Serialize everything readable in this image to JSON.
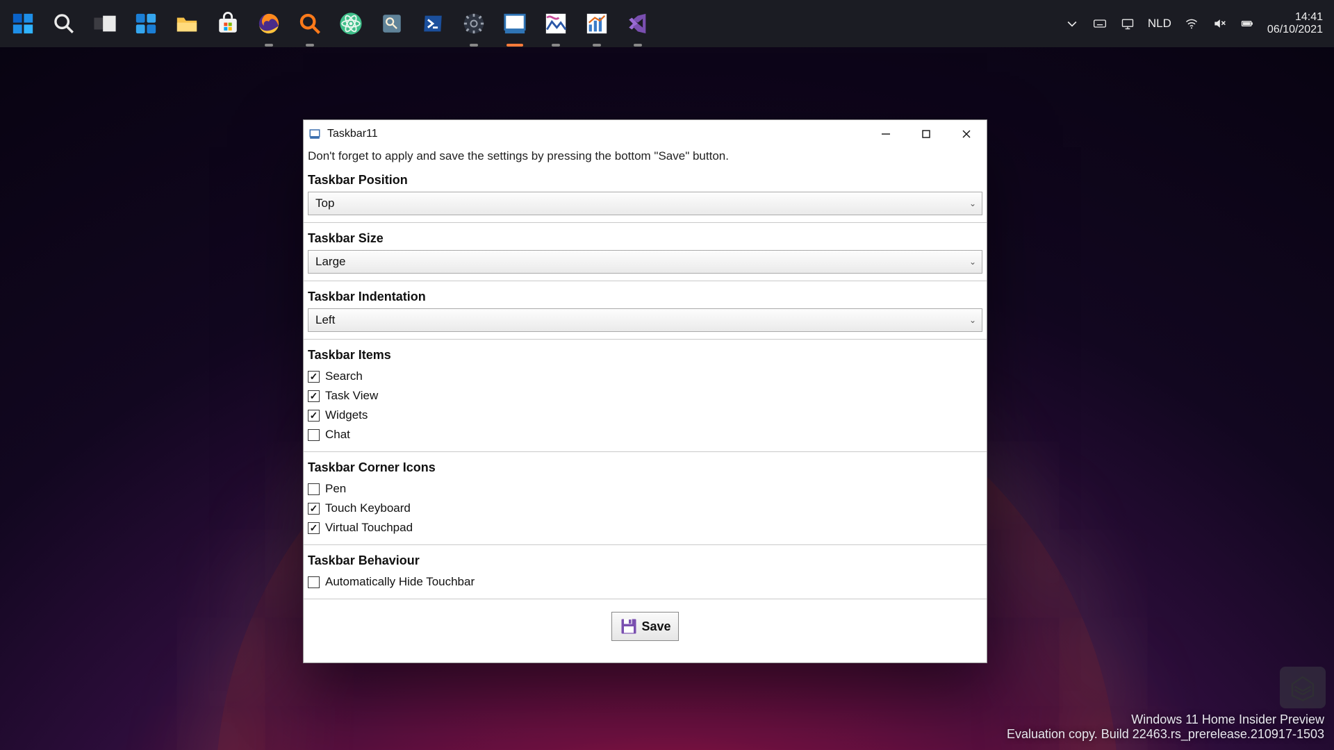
{
  "taskbar": {
    "icons": [
      {
        "name": "start-icon",
        "running": false
      },
      {
        "name": "search-icon",
        "running": false
      },
      {
        "name": "taskview-icon",
        "running": false
      },
      {
        "name": "widgets-icon",
        "running": false
      },
      {
        "name": "file-explorer-icon",
        "running": false
      },
      {
        "name": "microsoft-store-icon",
        "running": false
      },
      {
        "name": "firefox-icon",
        "running": true
      },
      {
        "name": "everything-search-icon",
        "running": true
      },
      {
        "name": "atom-icon",
        "running": false
      },
      {
        "name": "preview-icon",
        "running": false
      },
      {
        "name": "powershell-icon",
        "running": false
      },
      {
        "name": "settings-icon",
        "running": true
      },
      {
        "name": "taskbar11-icon",
        "running": true,
        "active": true
      },
      {
        "name": "paintdotnet-icon",
        "running": true
      },
      {
        "name": "chart-app-icon",
        "running": true
      },
      {
        "name": "visual-studio-icon",
        "running": true
      }
    ]
  },
  "tray": {
    "overflow_chevron": "⌄",
    "language": "NLD",
    "clock": {
      "time": "14:41",
      "date": "06/10/2021"
    }
  },
  "window": {
    "title": "Taskbar11",
    "hint": "Don't forget to apply and save the settings by pressing the bottom \"Save\" button.",
    "sections": {
      "position": {
        "heading": "Taskbar Position",
        "value": "Top"
      },
      "size": {
        "heading": "Taskbar Size",
        "value": "Large"
      },
      "indent": {
        "heading": "Taskbar Indentation",
        "value": "Left"
      },
      "items": {
        "heading": "Taskbar Items",
        "options": [
          {
            "label": "Search",
            "checked": true
          },
          {
            "label": "Task View",
            "checked": true
          },
          {
            "label": "Widgets",
            "checked": true
          },
          {
            "label": "Chat",
            "checked": false
          }
        ]
      },
      "corner": {
        "heading": "Taskbar Corner Icons",
        "options": [
          {
            "label": "Pen",
            "checked": false
          },
          {
            "label": "Touch Keyboard",
            "checked": true
          },
          {
            "label": "Virtual Touchpad",
            "checked": true
          }
        ]
      },
      "behaviour": {
        "heading": "Taskbar Behaviour",
        "options": [
          {
            "label": "Automatically Hide Touchbar",
            "checked": false
          }
        ]
      }
    },
    "save_label": "Save"
  },
  "watermark": {
    "line1": "Windows 11 Home Insider Preview",
    "line2": "Evaluation copy. Build 22463.rs_prerelease.210917-1503"
  }
}
